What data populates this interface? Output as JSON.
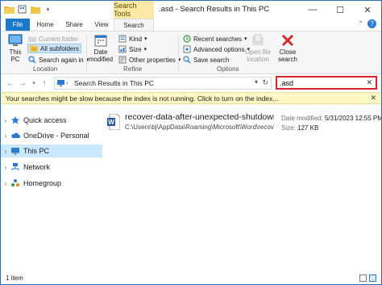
{
  "window": {
    "title": ".asd - Search Results in This PC",
    "contextual_tab_group": "Search Tools",
    "controls": [
      "—",
      "☐",
      "✕"
    ]
  },
  "ribbon_tabs": [
    "File",
    "Home",
    "Share",
    "View",
    "Search"
  ],
  "ribbon": {
    "location": {
      "label": "Location",
      "this_pc": "This PC",
      "current_folder": "Current folder",
      "all_subfolders": "All subfolders",
      "search_again": "Search again in"
    },
    "refine": {
      "label": "Refine",
      "date_modified": "Date modified",
      "kind": "Kind",
      "size": "Size",
      "other_properties": "Other properties"
    },
    "options": {
      "label": "Options",
      "recent_searches": "Recent searches",
      "advanced_options": "Advanced options",
      "save_search": "Save search",
      "open_file_location": "Open file location",
      "close_search": "Close search"
    }
  },
  "address_bar": {
    "path": "Search Results in This PC"
  },
  "search": {
    "value": ".asd"
  },
  "info_bar": {
    "message": "Your searches might be slow because the index is not running.  Click to turn on the index..."
  },
  "nav_pane": {
    "items": [
      {
        "label": "Quick access"
      },
      {
        "label": "OneDrive - Personal"
      },
      {
        "label": "This PC"
      },
      {
        "label": "Network"
      },
      {
        "label": "Homegroup"
      }
    ]
  },
  "results": [
    {
      "name": "recover-data-after-unexpected-shutdown((...",
      "path": "C:\\Users\\bj\\AppData\\Roaming\\Microsoft\\Word\\recov...",
      "date_label": "Date modified:",
      "date_value": "5/31/2023 12:55 PM",
      "size_label": "Size:",
      "size_value": "127 KB"
    }
  ],
  "status_bar": {
    "count": "1 item"
  },
  "colors": {
    "file_tab": "#1979ca",
    "search_tools": "#fde8a5",
    "search_highlight": "#d9252b",
    "info_bar": "#fff8c4",
    "selected": "#cce8ff"
  }
}
